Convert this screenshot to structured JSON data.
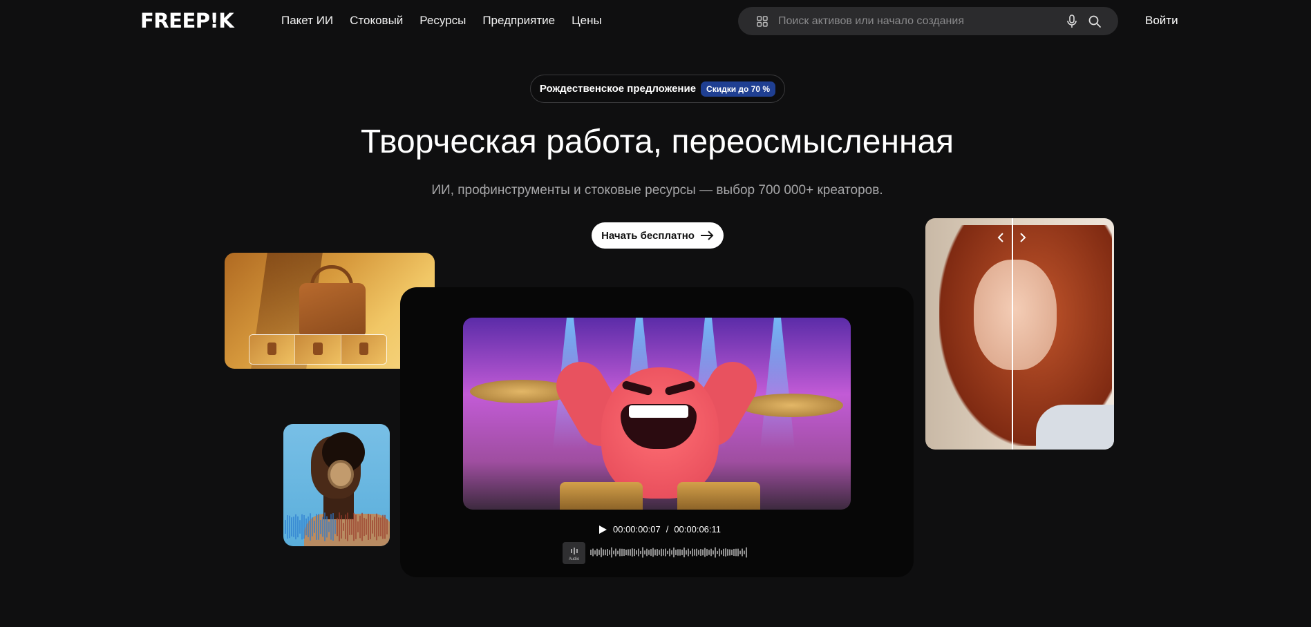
{
  "header": {
    "logo": "FREEP!K",
    "nav": [
      "Пакет ИИ",
      "Стоковый",
      "Ресурсы",
      "Предприятие",
      "Цены"
    ],
    "search_placeholder": "Поиск активов или начало создания",
    "login": "Войти"
  },
  "hero": {
    "promo_text": "Рождественское предложение",
    "promo_badge": "Скидки до 70 %",
    "headline": "Творческая работа, переосмысленная",
    "subheadline": "ИИ, профинструменты и стоковые ресурсы — выбор 700 000+ креаторов.",
    "cta": "Начать бесплатно"
  },
  "player": {
    "current_time": "00:00:00:07",
    "separator": "/",
    "total_time": "00:00:06:11",
    "audio_label": "Audio"
  },
  "colors": {
    "background": "#0f0f10",
    "badge": "#1f3f92",
    "search_bg": "#2b2b2d"
  },
  "icons": [
    "grid-icon",
    "mic-icon",
    "search-icon",
    "arrow-right-icon",
    "play-icon",
    "audio-icon",
    "chevron-left-icon",
    "chevron-right-icon"
  ]
}
